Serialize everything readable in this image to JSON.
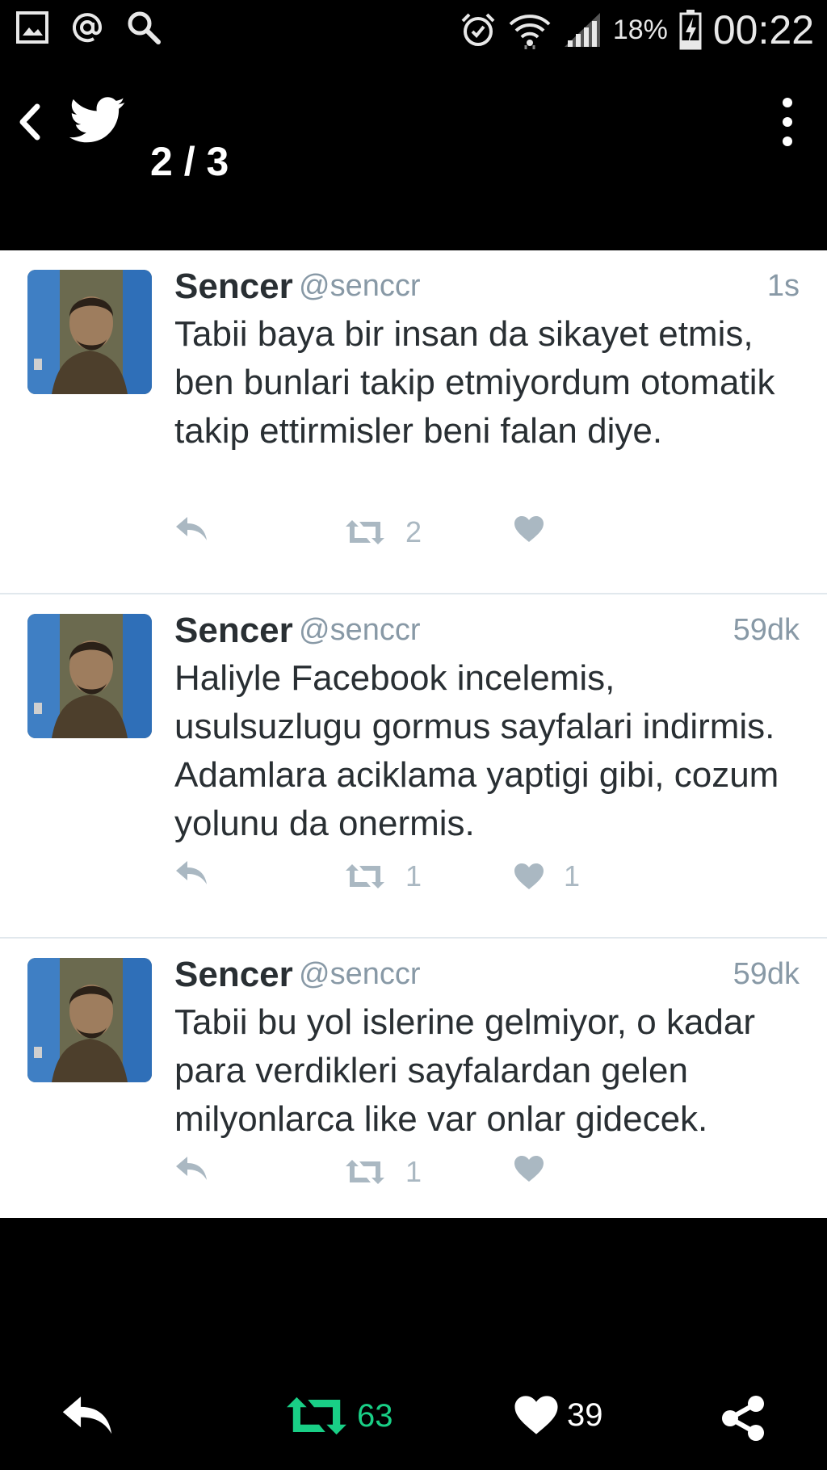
{
  "status_bar": {
    "icons_left": [
      "gallery-icon",
      "at-icon",
      "search-icon"
    ],
    "icons_right": [
      "alarm-icon",
      "wifi-icon",
      "signal-icon"
    ],
    "battery_percent": "18%",
    "time": "00:22"
  },
  "toolbar": {
    "pager": "2 / 3"
  },
  "tweets": [
    {
      "name": "Sencer",
      "handle": "@senccr",
      "time": "1s",
      "text": "Tabii baya bir insan da sikayet etmis, ben bunlari takip etmiyordum otomatik takip ettirmisler beni falan diye.",
      "retweets": "2",
      "likes": ""
    },
    {
      "name": "Sencer",
      "handle": "@senccr",
      "time": "59dk",
      "text": "Haliyle Facebook incelemis, usulsuzlugu gormus sayfalari indirmis. Adamlara aciklama yaptigi gibi, cozum yolunu da onermis.",
      "retweets": "1",
      "likes": "1"
    },
    {
      "name": "Sencer",
      "handle": "@senccr",
      "time": "59dk",
      "text": "Tabii bu yol islerine gelmiyor, o kadar para verdikleri sayfalardan gelen milyonlarca like var onlar gidecek.",
      "retweets": "1",
      "likes": ""
    }
  ],
  "bottom_bar": {
    "retweet_count": "63",
    "like_count": "39"
  },
  "colors": {
    "retweet_active": "#19cf86",
    "action_gray": "#aab8c2",
    "text": "#292f33",
    "secondary": "#8899a6"
  }
}
